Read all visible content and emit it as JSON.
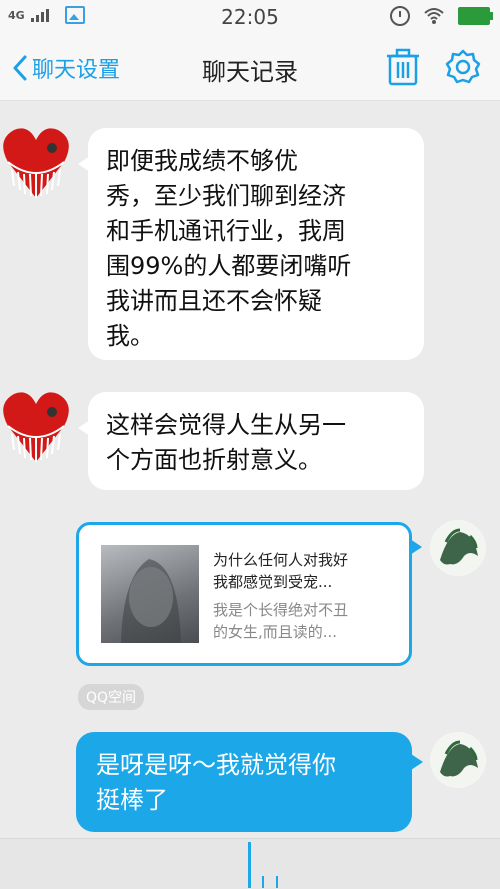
{
  "status_bar": {
    "network": "4G",
    "time": "22:05",
    "icons": [
      "signal-icon",
      "image-icon",
      "alarm-icon",
      "wifi-icon",
      "battery-icon"
    ]
  },
  "header": {
    "back_label": "聊天设置",
    "title": "聊天记录",
    "icons": [
      "chevron-left-icon",
      "trash-icon",
      "gear-icon"
    ],
    "accent_color": "#1aa0e6"
  },
  "messages": [
    {
      "sender": "other",
      "avatar": "heart-avatar",
      "lines": [
        "即便我成绩不够优",
        "秀，至少我们聊到经济",
        "和手机通讯行业，我周",
        "围99%的人都要闭嘴听",
        "我讲而且还不会怀疑",
        "我。"
      ]
    },
    {
      "sender": "other",
      "avatar": "heart-avatar",
      "lines": [
        "这样会觉得人生从另一",
        "个方面也折射意义。"
      ]
    },
    {
      "sender": "self",
      "type": "share-card",
      "title_lines": [
        "为什么任何人对我好",
        "我都感觉到受宠..."
      ],
      "desc_lines": [
        "我是个长得绝对不丑",
        "的女生,而且读的..."
      ],
      "source": "QQ空间"
    },
    {
      "sender": "self",
      "lines": [
        "是呀是呀～我就觉得你",
        "挺棒了"
      ]
    }
  ],
  "colors": {
    "background": "#ebebeb",
    "self_bubble": "#1ba7e8",
    "other_bubble": "#ffffff"
  }
}
